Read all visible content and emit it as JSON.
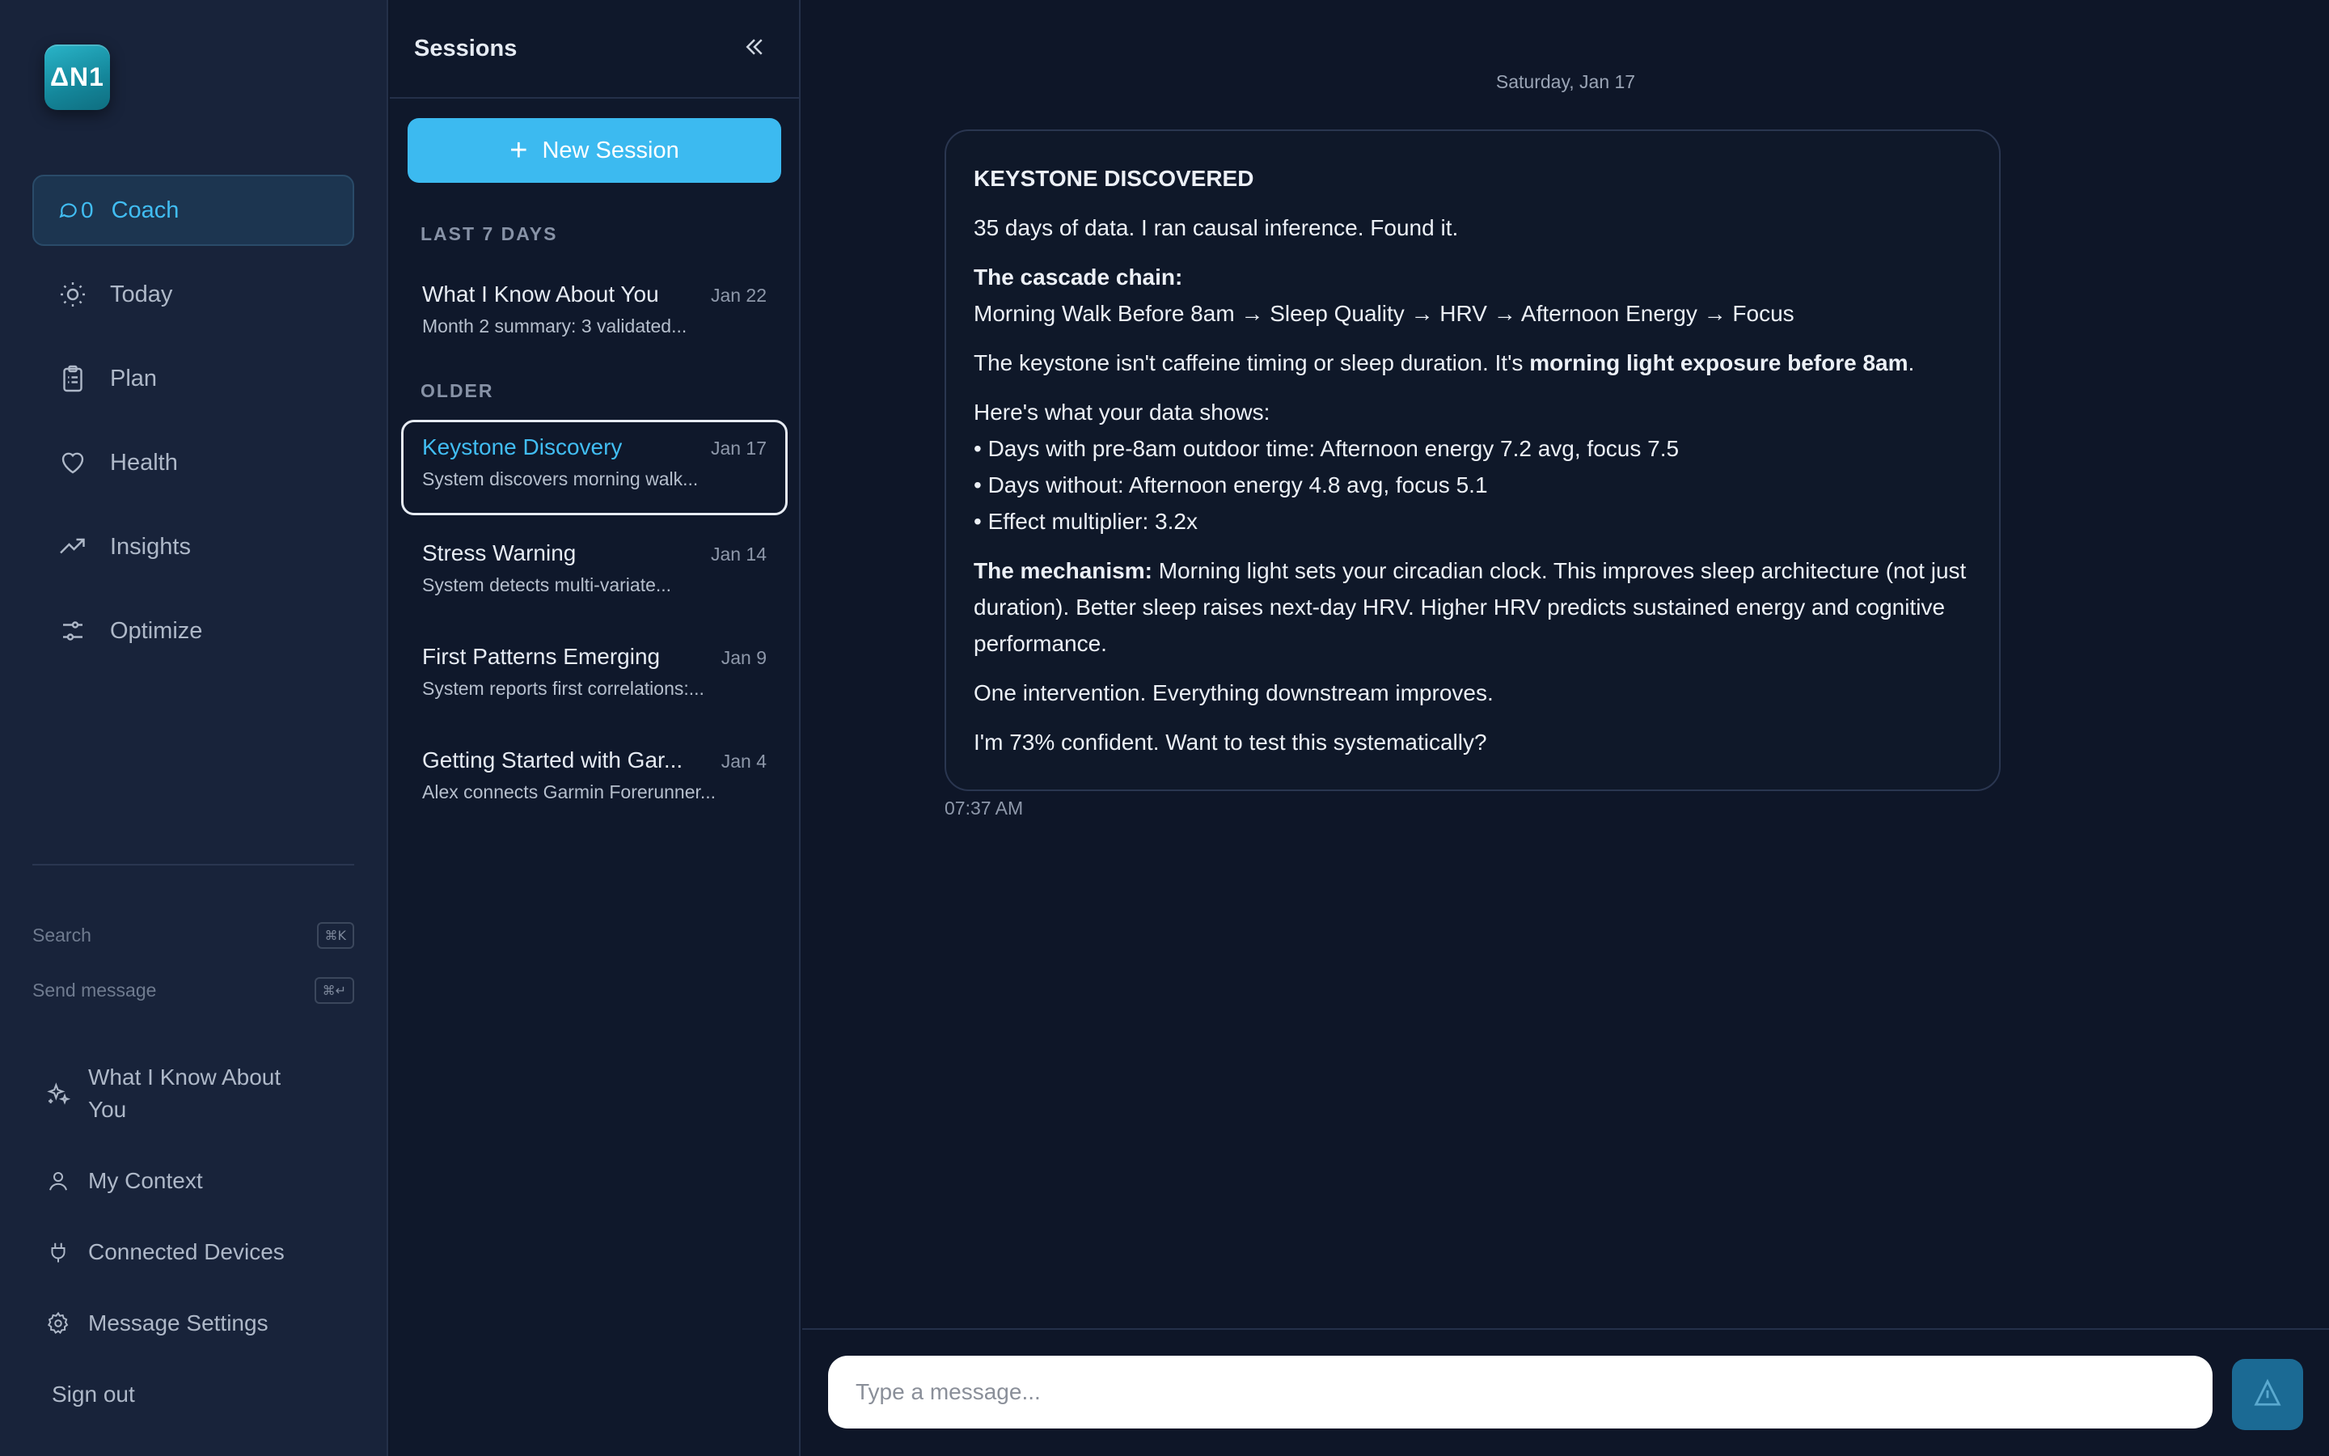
{
  "app": {
    "logo_text": "ΔN1"
  },
  "nav": {
    "items": [
      {
        "label": "Coach",
        "badge": "0",
        "icon": "chat-icon",
        "active": true
      },
      {
        "label": "Today",
        "icon": "sun-icon"
      },
      {
        "label": "Plan",
        "icon": "clipboard-icon"
      },
      {
        "label": "Health",
        "icon": "heart-icon"
      },
      {
        "label": "Insights",
        "icon": "trending-up-icon"
      },
      {
        "label": "Optimize",
        "icon": "sliders-icon"
      }
    ],
    "shortcuts": [
      {
        "label": "Search",
        "key": "⌘K"
      },
      {
        "label": "Send message",
        "key": "⌘↵"
      }
    ],
    "bottom": [
      {
        "label": "What I Know About You",
        "icon": "sparkles-icon"
      },
      {
        "label": "My Context",
        "icon": "user-icon"
      },
      {
        "label": "Connected Devices",
        "icon": "plug-icon"
      },
      {
        "label": "Message Settings",
        "icon": "gear-icon"
      }
    ],
    "sign_out": "Sign out"
  },
  "sessions": {
    "title": "Sessions",
    "new_button": "New Session",
    "groups": [
      {
        "label": "LAST 7 DAYS",
        "items": [
          {
            "title": "What I Know About You",
            "date": "Jan 22",
            "preview": "Month 2 summary: 3 validated..."
          }
        ]
      },
      {
        "label": "OLDER",
        "items": [
          {
            "title": "Keystone Discovery",
            "date": "Jan 17",
            "preview": "System discovers morning walk...",
            "active": true
          },
          {
            "title": "Stress Warning",
            "date": "Jan 14",
            "preview": "System detects multi-variate..."
          },
          {
            "title": "First Patterns Emerging",
            "date": "Jan 9",
            "preview": "System reports first correlations:..."
          },
          {
            "title": "Getting Started with Gar...",
            "date": "Jan 4",
            "preview": "Alex connects Garmin Forerunner..."
          }
        ]
      }
    ]
  },
  "chat": {
    "day": "Saturday, Jan 17",
    "message": {
      "heading": "KEYSTONE DISCOVERED",
      "p1": "35 days of data. I ran causal inference. Found it.",
      "chain_label": "The cascade chain:",
      "chain": "Morning Walk Before 8am → Sleep Quality → HRV → Afternoon Energy → Focus",
      "keystone_pre": "The keystone isn't caffeine timing or sleep duration. It's ",
      "keystone_bold": "morning light exposure before 8am",
      "keystone_post": ".",
      "data_intro": "Here's what your data shows:",
      "bullets": [
        "• Days with pre-8am outdoor time: Afternoon energy 7.2 avg, focus 7.5",
        "• Days without: Afternoon energy 4.8 avg, focus 5.1",
        "• Effect multiplier: 3.2x"
      ],
      "mechanism_label": "The mechanism:",
      "mechanism": " Morning light sets your circadian clock. This improves sleep architecture (not just duration). Better sleep raises next-day HRV. Higher HRV predicts sustained energy and cognitive performance.",
      "p_intervention": "One intervention. Everything downstream improves.",
      "p_confidence": "I'm 73% confident. Want to test this systematically?"
    },
    "timestamp": "07:37 AM",
    "input_placeholder": "Type a message..."
  }
}
